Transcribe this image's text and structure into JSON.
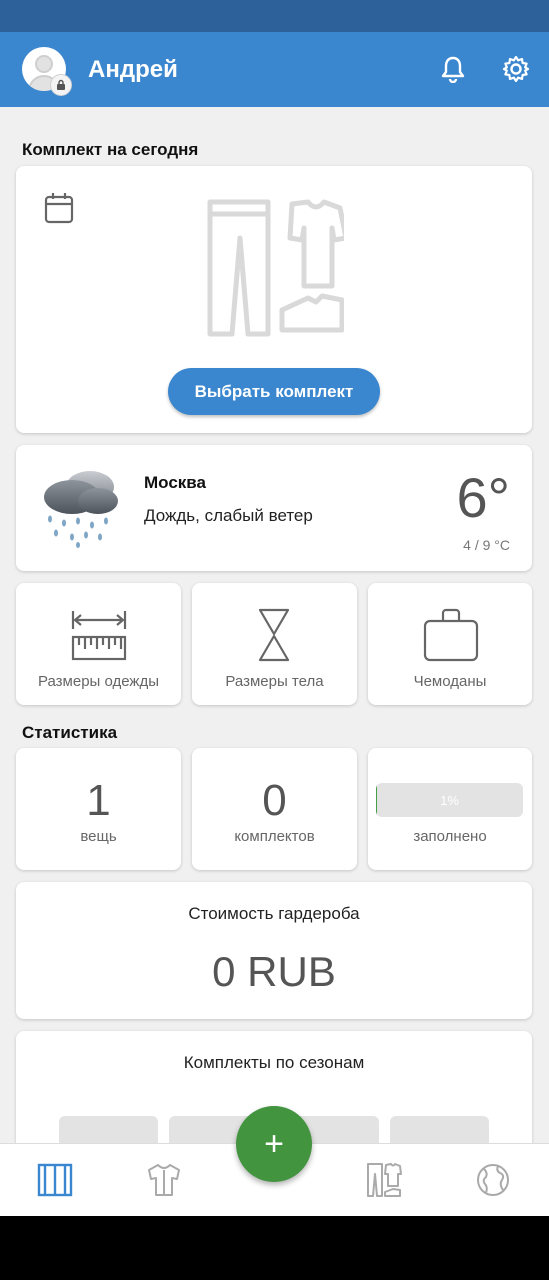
{
  "header": {
    "user_name": "Андрей"
  },
  "outfit_today": {
    "section_title": "Комплект на сегодня",
    "choose_button": "Выбрать комплект"
  },
  "weather": {
    "city": "Москва",
    "description": "Дождь, слабый ветер",
    "temperature": "6°",
    "range": "4 / 9 °C"
  },
  "tools": {
    "items": [
      {
        "label": "Размеры одежды"
      },
      {
        "label": "Размеры тела"
      },
      {
        "label": "Чемоданы"
      }
    ]
  },
  "statistics": {
    "section_title": "Статистика",
    "items_count": "1",
    "items_label": "вещь",
    "outfits_count": "0",
    "outfits_label": "комплектов",
    "filled_percent_text": "1%",
    "filled_fraction": 0.01,
    "filled_label": "заполнено"
  },
  "wardrobe_cost": {
    "title": "Стоимость гардероба",
    "value": "0 RUB"
  },
  "seasons": {
    "title": "Комплекты по сезонам"
  },
  "bottom_nav": {
    "items": [
      {
        "icon": "wardrobe-icon",
        "active": true
      },
      {
        "icon": "shirt-icon",
        "active": false
      },
      {
        "icon": "outfit-icon",
        "active": false
      },
      {
        "icon": "globe-icon",
        "active": false
      }
    ],
    "fab_label": "+"
  },
  "colors": {
    "primary": "#3b87cf",
    "status_bar": "#2d6199",
    "accent_green": "#43943f"
  }
}
